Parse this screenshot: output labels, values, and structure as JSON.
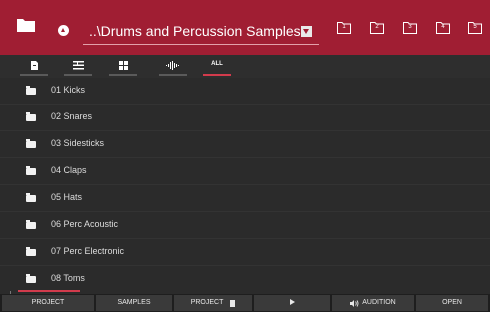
{
  "header": {
    "path": "..\\Drums and Percussion Samples",
    "slots": [
      "1",
      "2",
      "3",
      "4",
      "5"
    ]
  },
  "tabs": [
    {
      "id": "file",
      "icon": "document-icon",
      "active": false
    },
    {
      "id": "list",
      "icon": "list-view-icon",
      "active": false
    },
    {
      "id": "grid",
      "icon": "grid-view-icon",
      "active": false
    },
    {
      "id": "waveform",
      "icon": "waveform-icon",
      "active": false
    },
    {
      "id": "all",
      "icon": "",
      "label": "ALL",
      "active": true
    }
  ],
  "items": [
    {
      "name": "01 Kicks"
    },
    {
      "name": "02 Snares"
    },
    {
      "name": "03 Sidesticks"
    },
    {
      "name": "04 Claps"
    },
    {
      "name": "05 Hats"
    },
    {
      "name": "06 Perc Acoustic"
    },
    {
      "name": "07 Perc Electronic"
    },
    {
      "name": "08 Toms"
    }
  ],
  "bottom": {
    "project": "PROJECT",
    "samples": "SAMPLES",
    "project2": "PROJECT",
    "audition": "AUDITION",
    "open": "OPEN"
  },
  "colors": {
    "accent": "#a01e33",
    "highlight": "#d23b4c"
  }
}
